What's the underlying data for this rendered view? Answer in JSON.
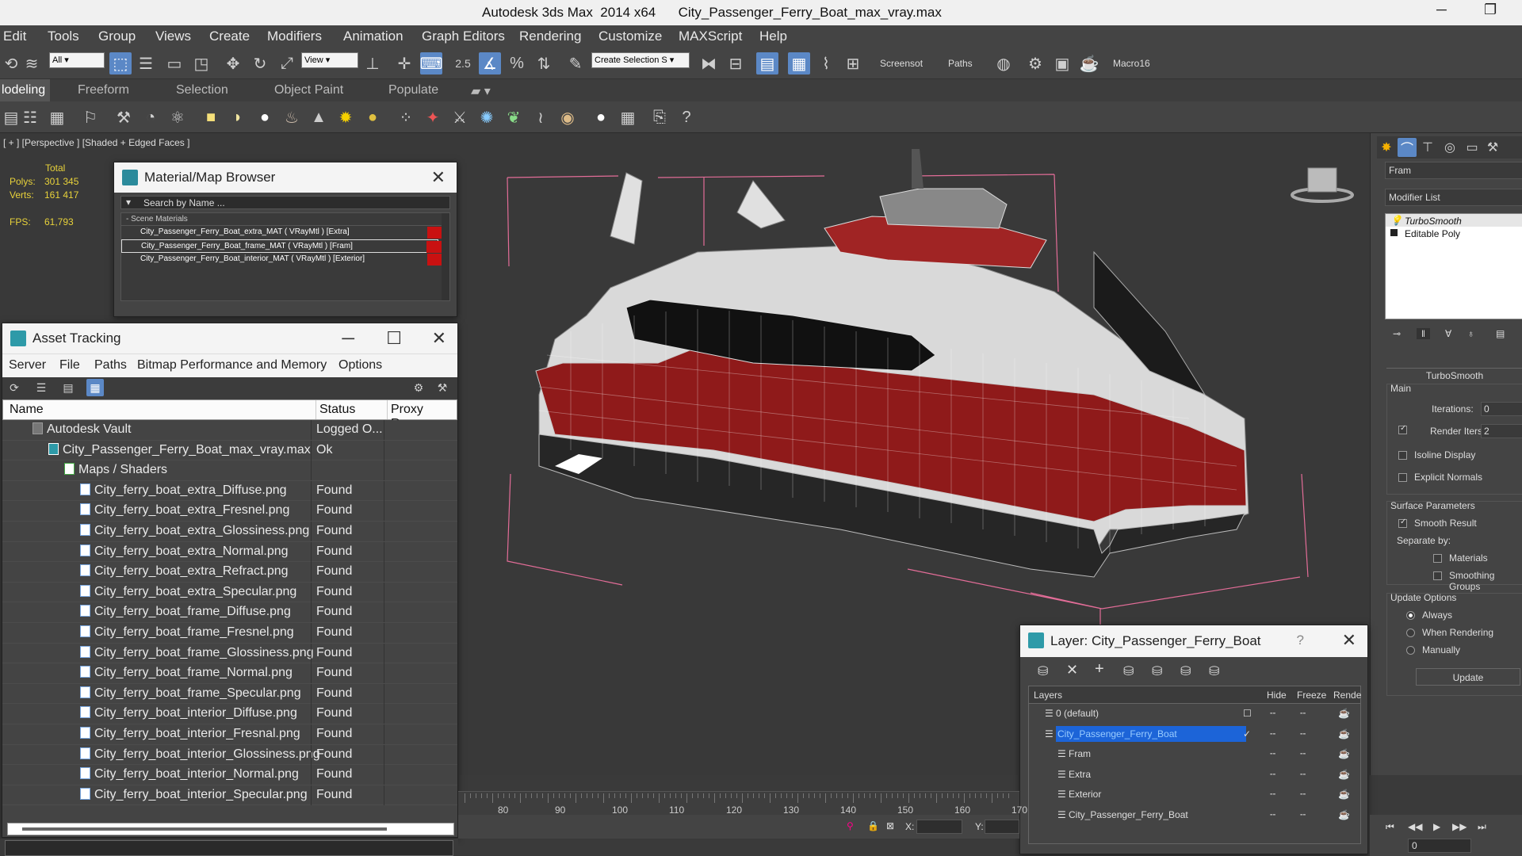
{
  "titlebar": {
    "title": "Autodesk 3ds Max  2014 x64      City_Passenger_Ferry_Boat_max_vray.max",
    "minimize": "─",
    "restore": "❐"
  },
  "menu": [
    "Edit",
    "Tools",
    "Group",
    "Views",
    "Create",
    "Modifiers",
    "Animation",
    "Graph Editors",
    "Rendering",
    "Customize",
    "MAXScript",
    "Help"
  ],
  "toolbar": {
    "filter": "All",
    "ref_coord": "View",
    "snap_value": "2.5",
    "selection_set": "Create Selection S",
    "screenshot": "Screensot",
    "paths": "Paths",
    "macro": "Macro16"
  },
  "ribbon": {
    "tabs": [
      "lodeling",
      "Freeform",
      "Selection",
      "Object Paint",
      "Populate"
    ]
  },
  "viewport": {
    "label": "[ + ] [Perspective ] [Shaded + Edged Faces ]",
    "stats": {
      "total": "Total",
      "polys_label": "Polys:",
      "polys": "301 345",
      "verts_label": "Verts:",
      "verts": "161 417",
      "fps_label": "FPS:",
      "fps": "61,793"
    }
  },
  "material_browser": {
    "title": "Material/Map Browser",
    "search_placeholder": "Search by Name ...",
    "section": "- Scene Materials",
    "items": [
      "City_Passenger_Ferry_Boat_extra_MAT ( VRayMtl ) [Extra]",
      "City_Passenger_Ferry_Boat_frame_MAT ( VRayMtl ) [Fram]",
      "City_Passenger_Ferry_Boat_interior_MAT ( VRayMtl ) [Exterior]"
    ]
  },
  "asset_tracking": {
    "title": "Asset Tracking",
    "menu": [
      "Server",
      "File",
      "Paths",
      "Bitmap Performance and Memory",
      "Options"
    ],
    "columns": [
      "Name",
      "Status",
      "Proxy Res..."
    ],
    "rows": [
      {
        "name": "Autodesk Vault",
        "status": "Logged O...",
        "indent": 0,
        "icon": "vault"
      },
      {
        "name": "City_Passenger_Ferry_Boat_max_vray.max",
        "status": "Ok",
        "indent": 1,
        "icon": "max"
      },
      {
        "name": "Maps / Shaders",
        "status": "",
        "indent": 2,
        "icon": "folder"
      },
      {
        "name": "City_ferry_boat_extra_Diffuse.png",
        "status": "Found",
        "indent": 3,
        "icon": "file"
      },
      {
        "name": "City_ferry_boat_extra_Fresnel.png",
        "status": "Found",
        "indent": 3,
        "icon": "file"
      },
      {
        "name": "City_ferry_boat_extra_Glossiness.png",
        "status": "Found",
        "indent": 3,
        "icon": "file"
      },
      {
        "name": "City_ferry_boat_extra_Normal.png",
        "status": "Found",
        "indent": 3,
        "icon": "file"
      },
      {
        "name": "City_ferry_boat_extra_Refract.png",
        "status": "Found",
        "indent": 3,
        "icon": "file"
      },
      {
        "name": "City_ferry_boat_extra_Specular.png",
        "status": "Found",
        "indent": 3,
        "icon": "file"
      },
      {
        "name": "City_ferry_boat_frame_Diffuse.png",
        "status": "Found",
        "indent": 3,
        "icon": "file"
      },
      {
        "name": "City_ferry_boat_frame_Fresnel.png",
        "status": "Found",
        "indent": 3,
        "icon": "file"
      },
      {
        "name": "City_ferry_boat_frame_Glossiness.png",
        "status": "Found",
        "indent": 3,
        "icon": "file"
      },
      {
        "name": "City_ferry_boat_frame_Normal.png",
        "status": "Found",
        "indent": 3,
        "icon": "file"
      },
      {
        "name": "City_ferry_boat_frame_Specular.png",
        "status": "Found",
        "indent": 3,
        "icon": "file"
      },
      {
        "name": "City_ferry_boat_interior_Diffuse.png",
        "status": "Found",
        "indent": 3,
        "icon": "file"
      },
      {
        "name": "City_ferry_boat_interior_Fresnal.png",
        "status": "Found",
        "indent": 3,
        "icon": "file"
      },
      {
        "name": "City_ferry_boat_interior_Glossiness.png",
        "status": "Found",
        "indent": 3,
        "icon": "file"
      },
      {
        "name": "City_ferry_boat_interior_Normal.png",
        "status": "Found",
        "indent": 3,
        "icon": "file"
      },
      {
        "name": "City_ferry_boat_interior_Specular.png",
        "status": "Found",
        "indent": 3,
        "icon": "file"
      }
    ]
  },
  "command_panel": {
    "object_name": "Fram",
    "modifier_list": "Modifier List",
    "stack": [
      "TurboSmooth",
      "Editable Poly"
    ],
    "rollout_title": "TurboSmooth",
    "main": "Main",
    "iterations_label": "Iterations:",
    "iterations": "0",
    "render_iters_label": "Render Iters:",
    "render_iters": "2",
    "isoline": "Isoline Display",
    "explicit_normals": "Explicit Normals",
    "surface_params": "Surface Parameters",
    "smooth_result": "Smooth Result",
    "separate_by": "Separate by:",
    "materials": "Materials",
    "smoothing_groups": "Smoothing Groups",
    "update_options": "Update Options",
    "always": "Always",
    "when_rendering": "When Rendering",
    "manually": "Manually",
    "update": "Update"
  },
  "layer_dialog": {
    "title": "Layer: City_Passenger_Ferry_Boat",
    "help": "?",
    "columns": [
      "Layers",
      "Hide",
      "Freeze",
      "Rende"
    ],
    "rows": [
      {
        "name": "0 (default)",
        "indent": 0,
        "selected": false
      },
      {
        "name": "City_Passenger_Ferry_Boat",
        "indent": 0,
        "selected": true
      },
      {
        "name": "Fram",
        "indent": 1,
        "selected": false
      },
      {
        "name": "Extra",
        "indent": 1,
        "selected": false
      },
      {
        "name": "Exterior",
        "indent": 1,
        "selected": false
      },
      {
        "name": "City_Passenger_Ferry_Boat",
        "indent": 1,
        "selected": false
      }
    ]
  },
  "timeline": {
    "ticks": [
      "80",
      "90",
      "100",
      "110",
      "120",
      "130",
      "140",
      "150",
      "160",
      "170"
    ]
  },
  "status": {
    "x_label": "X:",
    "y_label": "Y:",
    "frame": "0"
  },
  "colors": {
    "accent": "#5b88c6",
    "material_swatch": "#c91111",
    "selection": "#1c64d8"
  }
}
